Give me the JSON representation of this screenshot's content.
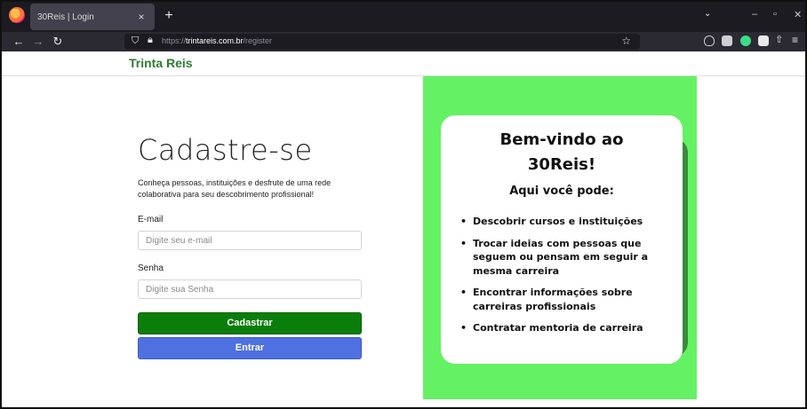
{
  "browser": {
    "tab_title": "30Reis | Login",
    "tab_close": "×",
    "new_tab": "+",
    "url_prefix": "https://",
    "url_host": "trintareis.com.br",
    "url_path": "/register"
  },
  "header": {
    "brand": "Trinta Reis"
  },
  "form": {
    "title": "Cadastre-se",
    "description": "Conheça pessoas, instituições e desfrute de uma rede colaborativa para seu descobrimento profissional!",
    "email_label": "E-mail",
    "email_placeholder": "Digite seu e-mail",
    "password_label": "Senha",
    "password_placeholder": "Digite sua Senha",
    "register_button": "Cadastrar",
    "enter_button": "Entrar"
  },
  "welcome": {
    "title_line1": "Bem-vindo ao",
    "title_line2": "30Reis!",
    "subtitle": "Aqui você pode:",
    "items": [
      "Descobrir cursos e instituições",
      "Trocar ideias com pessoas que seguem ou pensam em seguir a mesma carreira",
      "Encontrar informações sobre carreiras profissionais",
      "Contratar mentoria de carreira"
    ]
  },
  "colors": {
    "brand_green": "#2e7d32",
    "register_button": "#0b7d0b",
    "enter_button": "#4f70e0",
    "panel_green": "#64f264"
  }
}
